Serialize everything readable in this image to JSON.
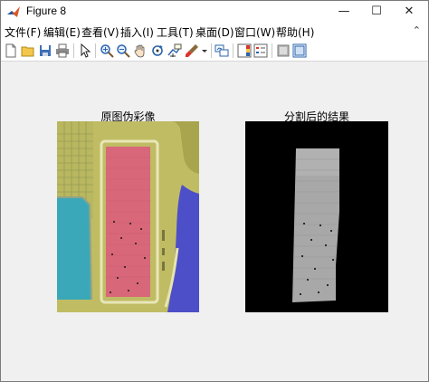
{
  "window": {
    "title": "Figure 8",
    "minimize_icon": "—",
    "maximize_icon": "☐",
    "close_icon": "✕"
  },
  "menu": {
    "items": [
      "文件(F)",
      "编辑(E)",
      "查看(V)",
      "插入(I)",
      "工具(T)",
      "桌面(D)",
      "窗口(W)",
      "帮助(H)"
    ],
    "expand_icon": "⌃"
  },
  "toolbar": {
    "icons": [
      "new-figure-icon",
      "open-file-icon",
      "save-icon",
      "print-icon",
      "pointer-icon",
      "zoom-in-icon",
      "zoom-out-icon",
      "pan-icon",
      "rotate-3d-icon",
      "data-cursor-icon",
      "brush-icon",
      "brush-dropdown-icon",
      "link-plot-icon",
      "colorbar-icon",
      "legend-icon",
      "hide-plot-tools-icon",
      "show-plot-tools-icon"
    ]
  },
  "axes": [
    {
      "title": "原图伪彩像"
    },
    {
      "title": "分割后的结果"
    }
  ],
  "colors": {
    "overlay_yellow": "#c9c56a",
    "overlay_cyan": "#3aa8b8",
    "overlay_red": "#d8677a",
    "overlay_blue": "#4d4fc8",
    "mask_black": "#000000",
    "strip_gray": "#a8a8a8"
  }
}
